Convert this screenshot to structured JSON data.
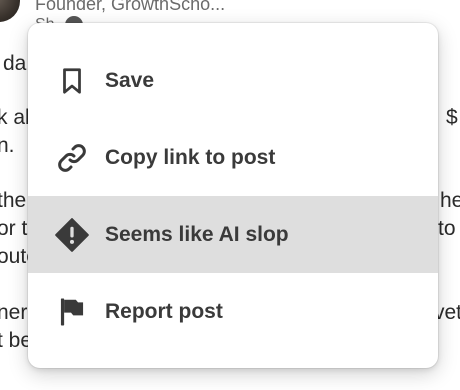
{
  "background": {
    "author_subtitle": "Founder, GrowthScho...",
    "meta_text": "Sh",
    "fragments": [
      {
        "text": "da"
      },
      {
        "text": "k ab"
      },
      {
        "text": "$"
      },
      {
        "text": "n."
      },
      {
        "text": "the"
      },
      {
        "text": "he"
      },
      {
        "text": "or t"
      },
      {
        "text": "to t"
      },
      {
        "text": "oute"
      },
      {
        "text": "nere"
      },
      {
        "text": "vet"
      },
      {
        "text": "t be"
      }
    ]
  },
  "menu": {
    "items": [
      {
        "label": "Save",
        "icon": "bookmark-icon",
        "highlighted": false
      },
      {
        "label": "Copy link to post",
        "icon": "link-icon",
        "highlighted": false
      },
      {
        "label": "Seems like AI slop",
        "icon": "warning-icon",
        "highlighted": true
      },
      {
        "label": "Report post",
        "icon": "flag-icon",
        "highlighted": false
      }
    ]
  },
  "colors": {
    "highlight": "#dedede",
    "label_text": "#3a3a3a",
    "icon": "#3a3a3a"
  }
}
